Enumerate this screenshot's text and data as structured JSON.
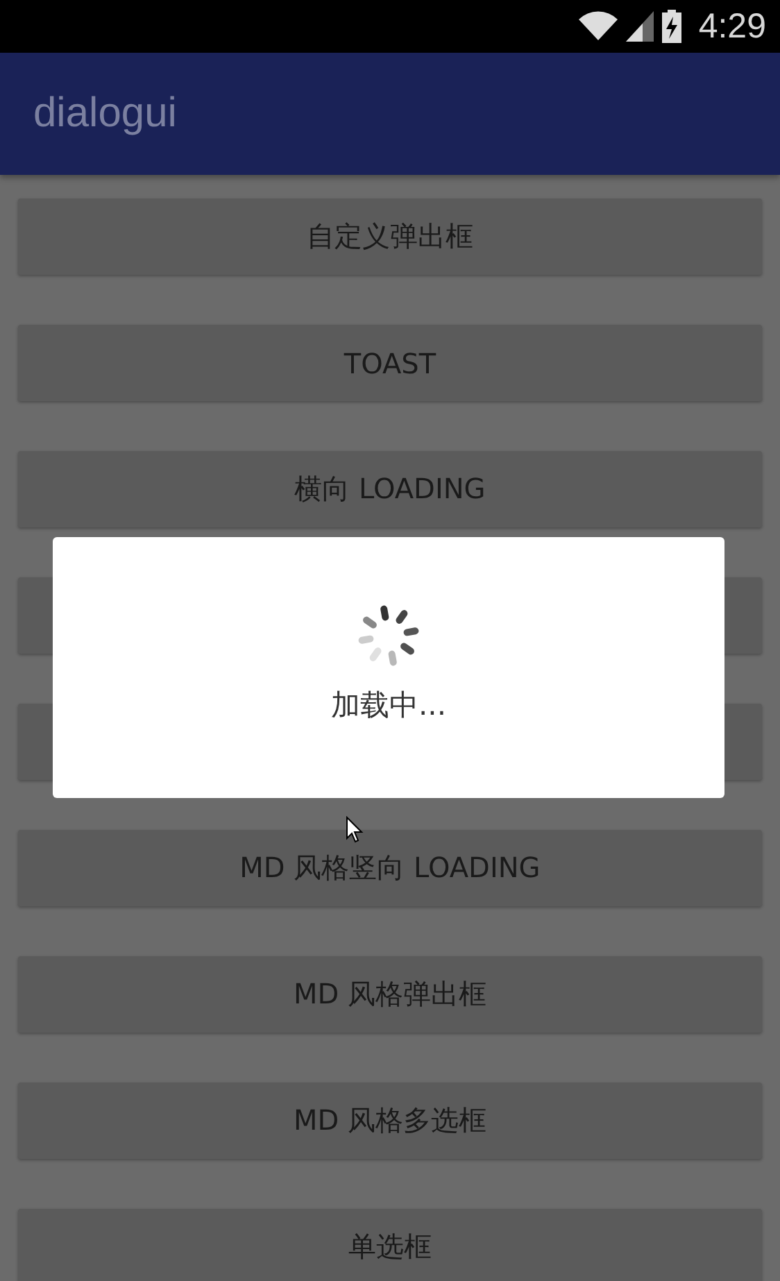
{
  "status_bar": {
    "time": "4:29"
  },
  "app_bar": {
    "title": "dialogui"
  },
  "buttons": [
    {
      "kind": "labelled",
      "label": "自定义弹出框"
    },
    {
      "kind": "labelled",
      "label": "TOAST"
    },
    {
      "kind": "labelled",
      "label": "横向 LOADING"
    },
    {
      "kind": "covered"
    },
    {
      "kind": "covered"
    },
    {
      "kind": "labelled",
      "label": "MD 风格竖向 LOADING"
    },
    {
      "kind": "labelled",
      "label": "MD 风格弹出框"
    },
    {
      "kind": "labelled",
      "label": "MD 风格多选框"
    },
    {
      "kind": "labelled",
      "label": "单选框"
    }
  ],
  "dialog": {
    "message": "加载中..."
  }
}
